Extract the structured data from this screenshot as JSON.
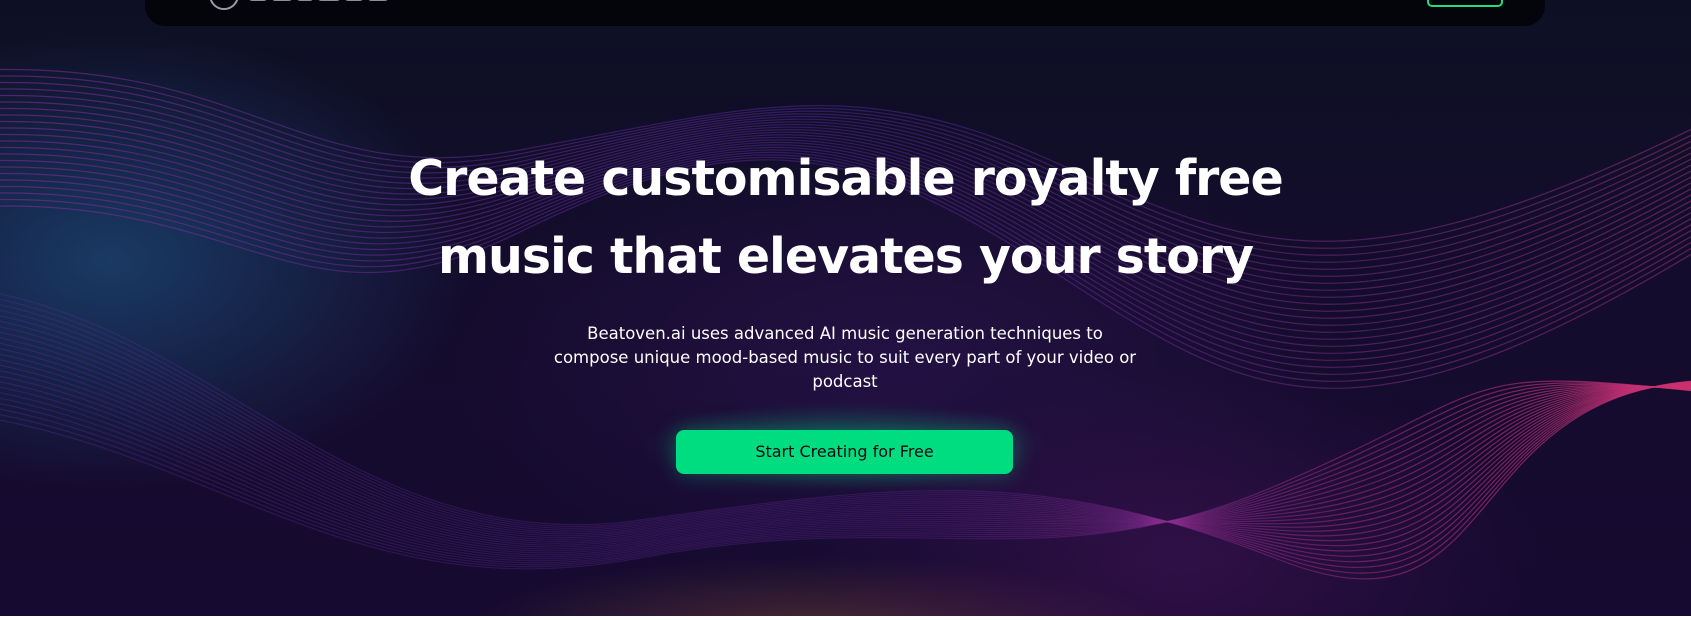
{
  "hero": {
    "headline_line1": "Create customisable royalty free",
    "headline_line2": "music that elevates your story",
    "description": "Beatoven.ai uses advanced AI music generation techniques to compose unique mood-based music to suit every part of your video or podcast",
    "cta_label": "Start Creating for Free"
  },
  "colors": {
    "background": "#140c2c",
    "wave_purple": "#7a2fb0",
    "wave_magenta": "#c0287a",
    "cta_green": "#00dd80",
    "headline_text": "#ffffff"
  },
  "icons": {
    "logo": "beatoven-logo-icon"
  }
}
